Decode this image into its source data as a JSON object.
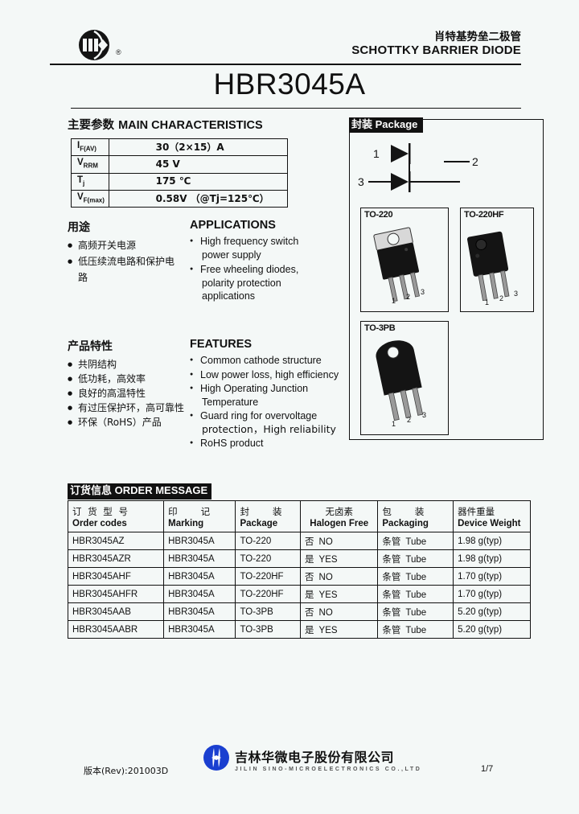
{
  "header": {
    "logo_alt": "JSM circular logo",
    "registered_mark": "®",
    "title_cn": "肖特基势垒二极管",
    "title_en": "SCHOTTKY BARRIER DIODE",
    "part_number": "HBR3045A"
  },
  "main_characteristics": {
    "title_cn": "主要参数",
    "title_en": "MAIN   CHARACTERISTICS",
    "rows": [
      {
        "symbol": "I",
        "sub": "F(AV)",
        "value": "30（2×15）A"
      },
      {
        "symbol": "V",
        "sub": "RRM",
        "value": "45 V"
      },
      {
        "symbol": "T",
        "sub": "j",
        "value": "175 ℃"
      },
      {
        "symbol": "V",
        "sub": "F(max)",
        "value": "0.58V （@Tj=125℃）"
      }
    ]
  },
  "applications": {
    "title_cn": "用途",
    "title_en": "APPLICATIONS",
    "items_cn": [
      "高频开关电源",
      "低压续流电路和保护电",
      "路"
    ],
    "items_en": [
      {
        "line1": "High frequency switch",
        "line2": "power supply"
      },
      {
        "line1": "Free wheeling diodes,",
        "line2": "polarity protection",
        "line3": "applications"
      }
    ]
  },
  "features": {
    "title_cn": "产品特性",
    "title_en": "FEATURES",
    "items_cn": [
      "共阴结构",
      "低功耗，高效率",
      "良好的高温特性",
      "有过压保护环，高可靠性",
      "环保（RoHS）产品"
    ],
    "items_en": [
      {
        "line1": "Common cathode structure"
      },
      {
        "line1": "Low power loss, high efficiency"
      },
      {
        "line1": "High Operating Junction",
        "line2": "Temperature"
      },
      {
        "line1": "Guard ring for overvoltage",
        "line2": "protection，High reliability"
      },
      {
        "line1": "RoHS product"
      }
    ]
  },
  "package_panel": {
    "tag_cn": "封装",
    "tag_en": "Package",
    "schematic": {
      "pin1_label": "1",
      "pin2_label": "2",
      "pin3_label": "3"
    },
    "packages": [
      {
        "name": "TO-220"
      },
      {
        "name": "TO-220HF"
      },
      {
        "name": "TO-3PB"
      }
    ]
  },
  "order_message": {
    "tag_cn": "订货信息",
    "tag_en": "ORDER MESSAGE",
    "columns": [
      {
        "cn": "订 货 型 号",
        "en": "Order codes"
      },
      {
        "cn": "印　　记",
        "en": "Marking"
      },
      {
        "cn": "封　　装",
        "en": "Package"
      },
      {
        "cn": "无卤素",
        "en": "Halogen Free"
      },
      {
        "cn": "包　　装",
        "en": "Packaging"
      },
      {
        "cn": "器件重量",
        "en": "Device Weight"
      }
    ],
    "rows": [
      {
        "order_code": "HBR3045AZ",
        "marking": "HBR3045A",
        "package": "TO-220",
        "hf_cn": "否",
        "hf_en": "NO",
        "packaging_cn": "条管",
        "packaging_en": "Tube",
        "weight": "1.98 g(typ)"
      },
      {
        "order_code": "HBR3045AZR",
        "marking": "HBR3045A",
        "package": "TO-220",
        "hf_cn": "是",
        "hf_en": "YES",
        "packaging_cn": "条管",
        "packaging_en": "Tube",
        "weight": "1.98 g(typ)"
      },
      {
        "order_code": "HBR3045AHF",
        "marking": "HBR3045A",
        "package": "TO-220HF",
        "hf_cn": "否",
        "hf_en": "NO",
        "packaging_cn": "条管",
        "packaging_en": "Tube",
        "weight": "1.70 g(typ)"
      },
      {
        "order_code": "HBR3045AHFR",
        "marking": "HBR3045A",
        "package": "TO-220HF",
        "hf_cn": "是",
        "hf_en": "YES",
        "packaging_cn": "条管",
        "packaging_en": "Tube",
        "weight": "1.70 g(typ)"
      },
      {
        "order_code": "HBR3045AAB",
        "marking": "HBR3045A",
        "package": "TO-3PB",
        "hf_cn": "否",
        "hf_en": "NO",
        "packaging_cn": "条管",
        "packaging_en": "Tube",
        "weight": "5.20 g(typ)"
      },
      {
        "order_code": "HBR3045AABR",
        "marking": "HBR3045A",
        "package": "TO-3PB",
        "hf_cn": "是",
        "hf_en": "YES",
        "packaging_cn": "条管",
        "packaging_en": "Tube",
        "weight": "5.20 g(typ)"
      }
    ]
  },
  "footer": {
    "company_cn": "吉林华微电子股份有限公司",
    "company_en": "JILIN SINO-MICROELECTRONICS CO.,LTD",
    "revision": "版本(Rev):201003D",
    "page": "1/7",
    "logo_color": "#1a3fd0"
  },
  "colors": {
    "page_background": "#f4f8f7",
    "ink": "#111111",
    "tag_background": "#111111",
    "tag_text": "#ffffff"
  }
}
